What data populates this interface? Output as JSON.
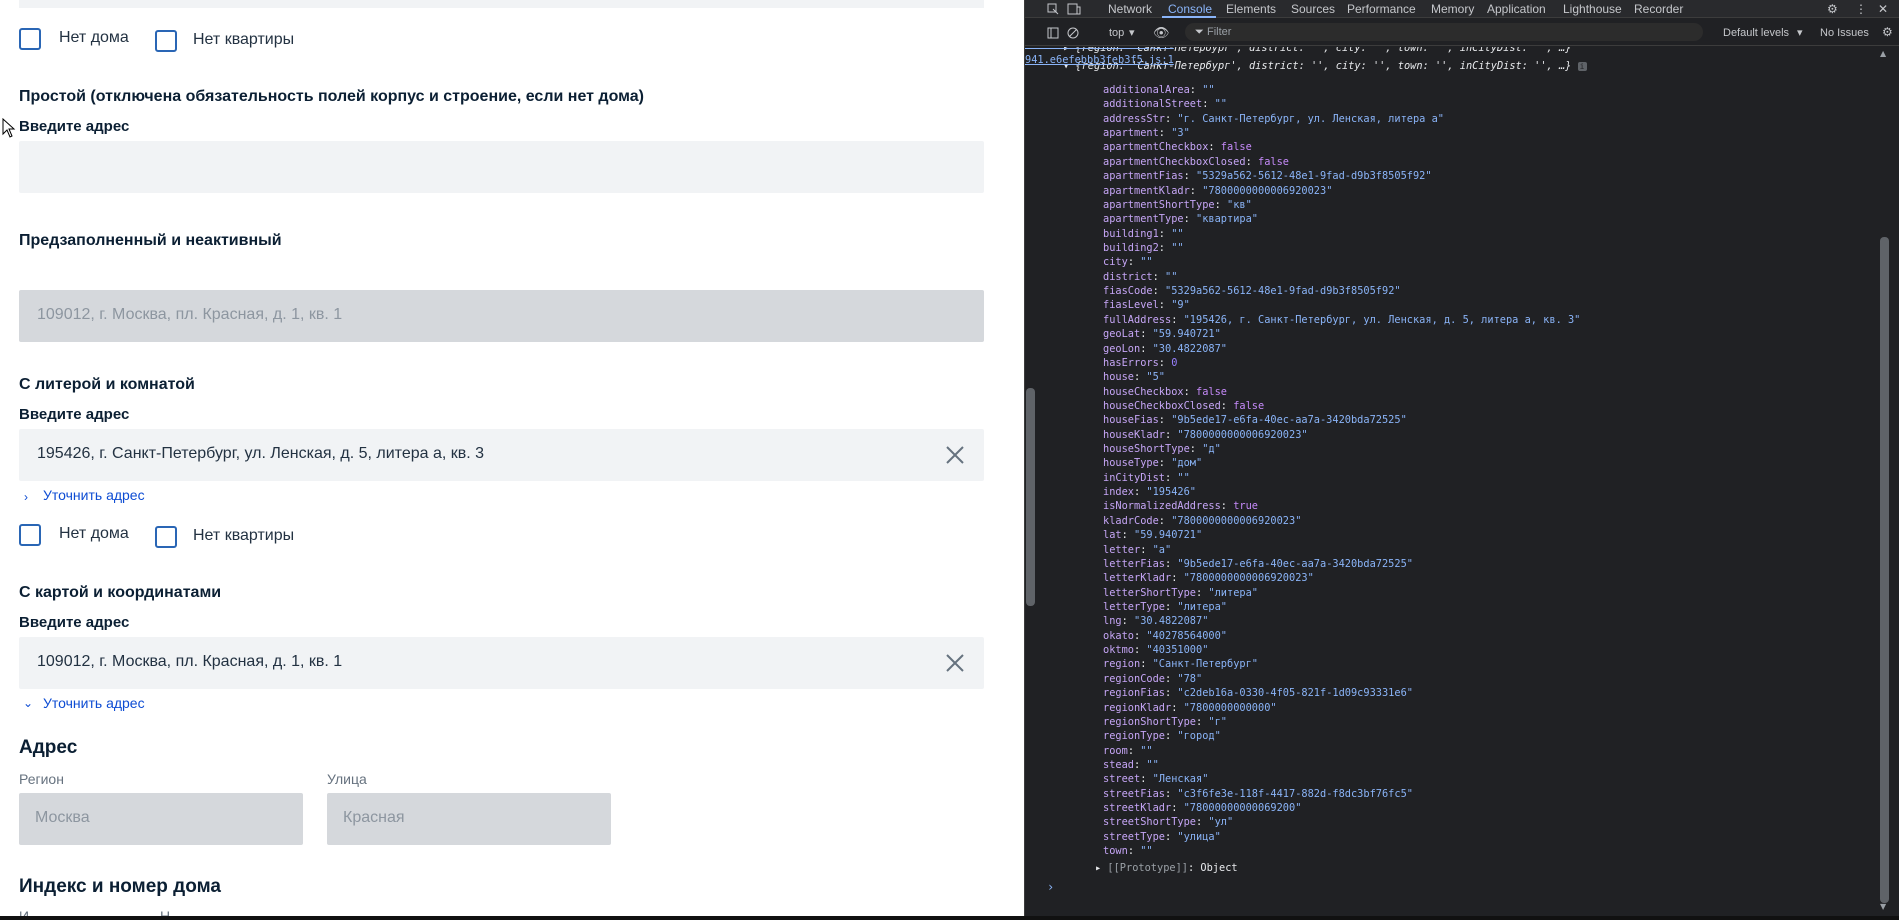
{
  "app": {
    "chk_no_house": "Нет дома",
    "chk_no_apartment": "Нет квартиры",
    "sec_simple": "Простой (отключена обязательность полей корпус и строение, если нет дома)",
    "label_enter_address": "Введите адрес",
    "sec_prefilled": "Предзаполненный и неактивный",
    "prefilled_value": "109012, г. Москва, пл. Красная, д. 1, кв. 1",
    "sec_litera": "С литерой и комнатой",
    "litera_value": "195426, г. Санкт-Петербург, ул. Ленская, д. 5, литера а, кв. 3",
    "link_refine": "Уточнить адрес",
    "sec_map": "С картой и координатами",
    "map_value": "109012, г. Москва, пл. Красная, д. 1, кв. 1",
    "sec_address": "Адрес",
    "label_region": "Регион",
    "label_street": "Улица",
    "region_value": "Москва",
    "street_value": "Красная",
    "sec_index": "Индекс и номер дома",
    "cut_label_1": "И",
    "cut_label_2": "Н"
  },
  "devtools": {
    "tabs": [
      "Network",
      "Console",
      "Elements",
      "Sources",
      "Performance",
      "Memory",
      "Application",
      "Lighthouse",
      "Recorder"
    ],
    "active_tab": "Console",
    "context": "top",
    "filter_placeholder": "Filter",
    "levels": "Default levels",
    "issues": "No Issues",
    "source_link": "941.e6efebbb3feb3f5.js:1",
    "summary_line": "{region: 'Санкт-Петербург', district: '', city: '', town: '', inCityDist: '', …}",
    "prototype_label": "[[Prototype]]",
    "prototype_value": "Object",
    "props": [
      {
        "k": "additionalArea",
        "v": "\"\"",
        "t": "str"
      },
      {
        "k": "additionalStreet",
        "v": "\"\"",
        "t": "str"
      },
      {
        "k": "addressStr",
        "v": "\"г. Санкт-Петербург, ул. Ленская, литера а\"",
        "t": "str"
      },
      {
        "k": "apartment",
        "v": "\"3\"",
        "t": "str"
      },
      {
        "k": "apartmentCheckbox",
        "v": "false",
        "t": "kw"
      },
      {
        "k": "apartmentCheckboxClosed",
        "v": "false",
        "t": "kw"
      },
      {
        "k": "apartmentFias",
        "v": "\"5329a562-5612-48e1-9fad-d9b3f8505f92\"",
        "t": "str"
      },
      {
        "k": "apartmentKladr",
        "v": "\"7800000000006920023\"",
        "t": "str"
      },
      {
        "k": "apartmentShortType",
        "v": "\"кв\"",
        "t": "str"
      },
      {
        "k": "apartmentType",
        "v": "\"квартира\"",
        "t": "str"
      },
      {
        "k": "building1",
        "v": "\"\"",
        "t": "str"
      },
      {
        "k": "building2",
        "v": "\"\"",
        "t": "str"
      },
      {
        "k": "city",
        "v": "\"\"",
        "t": "str"
      },
      {
        "k": "district",
        "v": "\"\"",
        "t": "str"
      },
      {
        "k": "fiasCode",
        "v": "\"5329a562-5612-48e1-9fad-d9b3f8505f92\"",
        "t": "str"
      },
      {
        "k": "fiasLevel",
        "v": "\"9\"",
        "t": "str"
      },
      {
        "k": "fullAddress",
        "v": "\"195426, г. Санкт-Петербург, ул. Ленская, д. 5, литера а, кв. 3\"",
        "t": "str"
      },
      {
        "k": "geoLat",
        "v": "\"59.940721\"",
        "t": "str"
      },
      {
        "k": "geoLon",
        "v": "\"30.4822087\"",
        "t": "str"
      },
      {
        "k": "hasErrors",
        "v": "0",
        "t": "num"
      },
      {
        "k": "house",
        "v": "\"5\"",
        "t": "str"
      },
      {
        "k": "houseCheckbox",
        "v": "false",
        "t": "kw"
      },
      {
        "k": "houseCheckboxClosed",
        "v": "false",
        "t": "kw"
      },
      {
        "k": "houseFias",
        "v": "\"9b5ede17-e6fa-40ec-aa7a-3420bda72525\"",
        "t": "str"
      },
      {
        "k": "houseKladr",
        "v": "\"7800000000006920023\"",
        "t": "str"
      },
      {
        "k": "houseShortType",
        "v": "\"д\"",
        "t": "str"
      },
      {
        "k": "houseType",
        "v": "\"дом\"",
        "t": "str"
      },
      {
        "k": "inCityDist",
        "v": "\"\"",
        "t": "str"
      },
      {
        "k": "index",
        "v": "\"195426\"",
        "t": "str"
      },
      {
        "k": "isNormalizedAddress",
        "v": "true",
        "t": "kw"
      },
      {
        "k": "kladrCode",
        "v": "\"7800000000006920023\"",
        "t": "str"
      },
      {
        "k": "lat",
        "v": "\"59.940721\"",
        "t": "str"
      },
      {
        "k": "letter",
        "v": "\"а\"",
        "t": "str"
      },
      {
        "k": "letterFias",
        "v": "\"9b5ede17-e6fa-40ec-aa7a-3420bda72525\"",
        "t": "str"
      },
      {
        "k": "letterKladr",
        "v": "\"7800000000006920023\"",
        "t": "str"
      },
      {
        "k": "letterShortType",
        "v": "\"литера\"",
        "t": "str"
      },
      {
        "k": "letterType",
        "v": "\"литера\"",
        "t": "str"
      },
      {
        "k": "lng",
        "v": "\"30.4822087\"",
        "t": "str"
      },
      {
        "k": "okato",
        "v": "\"40278564000\"",
        "t": "str"
      },
      {
        "k": "oktmo",
        "v": "\"40351000\"",
        "t": "str"
      },
      {
        "k": "region",
        "v": "\"Санкт-Петербург\"",
        "t": "str"
      },
      {
        "k": "regionCode",
        "v": "\"78\"",
        "t": "str"
      },
      {
        "k": "regionFias",
        "v": "\"c2deb16a-0330-4f05-821f-1d09c93331e6\"",
        "t": "str"
      },
      {
        "k": "regionKladr",
        "v": "\"7800000000000\"",
        "t": "str"
      },
      {
        "k": "regionShortType",
        "v": "\"г\"",
        "t": "str"
      },
      {
        "k": "regionType",
        "v": "\"город\"",
        "t": "str"
      },
      {
        "k": "room",
        "v": "\"\"",
        "t": "str"
      },
      {
        "k": "stead",
        "v": "\"\"",
        "t": "str"
      },
      {
        "k": "street",
        "v": "\"Ленская\"",
        "t": "str"
      },
      {
        "k": "streetFias",
        "v": "\"c3f6fe3e-118f-4417-882d-f8dc3bf76fc5\"",
        "t": "str"
      },
      {
        "k": "streetKladr",
        "v": "\"78000000000069200\"",
        "t": "str"
      },
      {
        "k": "streetShortType",
        "v": "\"ул\"",
        "t": "str"
      },
      {
        "k": "streetType",
        "v": "\"улица\"",
        "t": "str"
      },
      {
        "k": "town",
        "v": "\"\"",
        "t": "str"
      }
    ]
  }
}
